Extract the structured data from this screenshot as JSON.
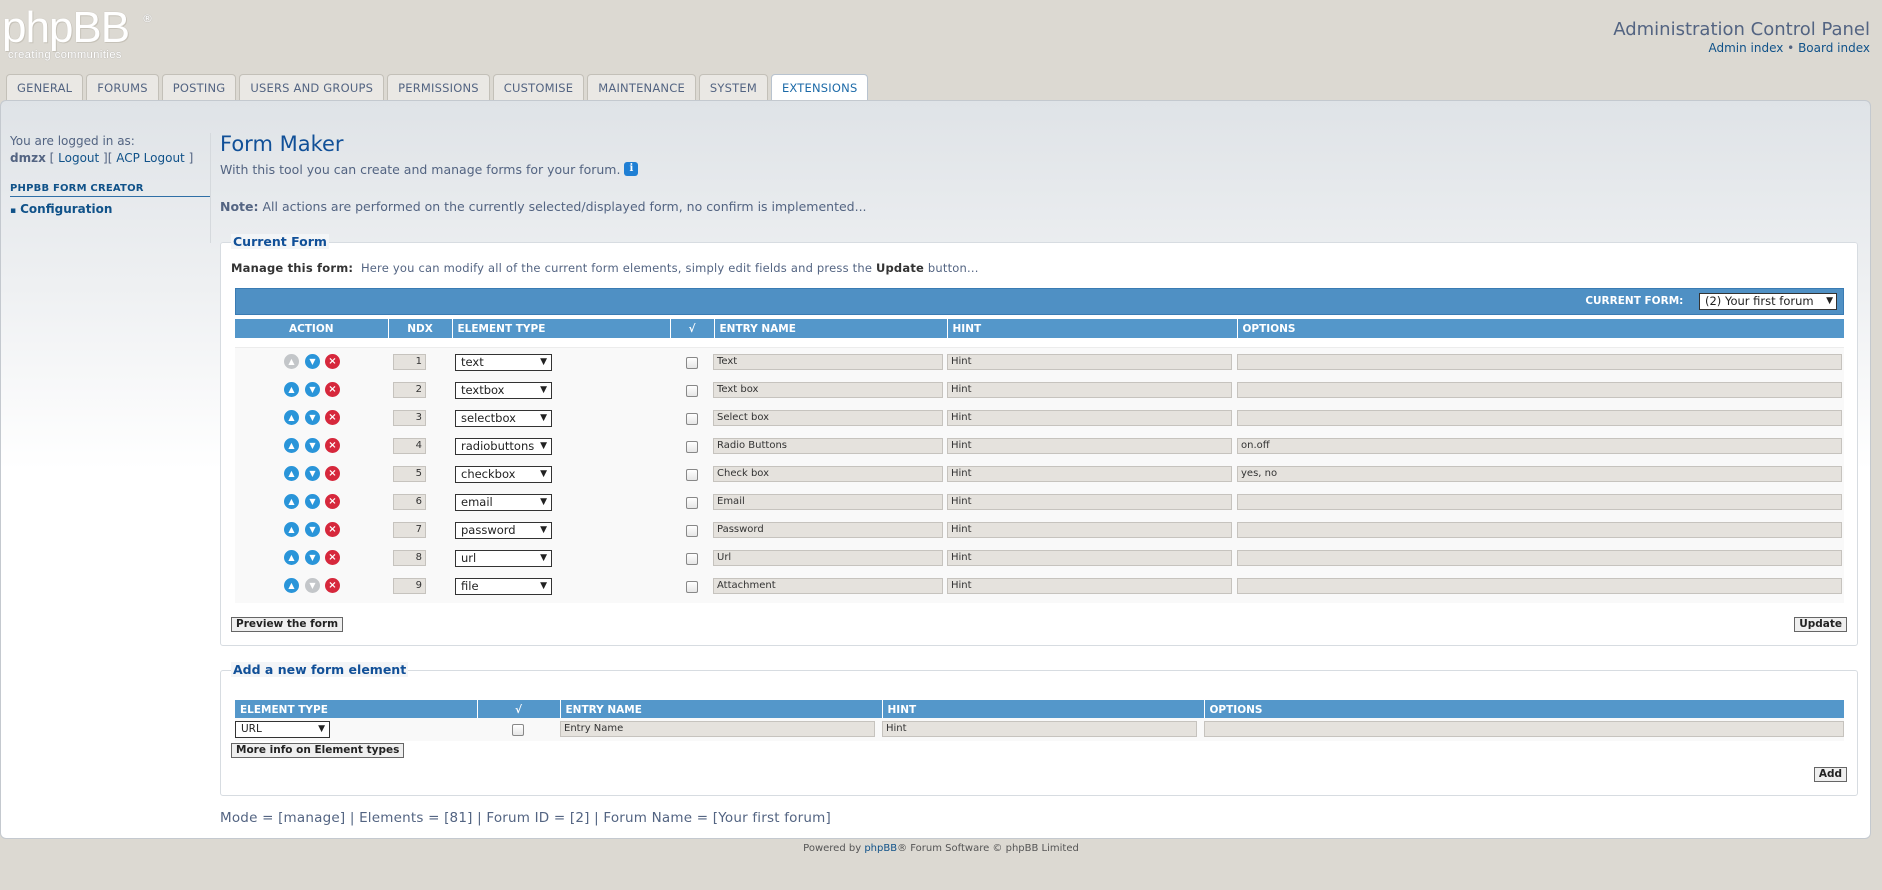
{
  "header": {
    "logo_text": "phpBB",
    "logo_tagline": "creating communities",
    "logo_reg": "®",
    "acp_title": "Administration Control Panel",
    "admin_index": "Admin index",
    "separator": "•",
    "board_index": "Board index"
  },
  "tabs": [
    {
      "label": "GENERAL"
    },
    {
      "label": "FORUMS"
    },
    {
      "label": "POSTING"
    },
    {
      "label": "USERS AND GROUPS"
    },
    {
      "label": "PERMISSIONS"
    },
    {
      "label": "CUSTOMISE"
    },
    {
      "label": "MAINTENANCE"
    },
    {
      "label": "SYSTEM"
    },
    {
      "label": "EXTENSIONS",
      "active": true
    }
  ],
  "sidebar": {
    "logged_in_as": "You are logged in as:",
    "username": "dmzx",
    "logout": "Logout",
    "acp_logout": "ACP Logout",
    "menu_heading": "PHPBB FORM CREATOR",
    "menu_item": "Configuration"
  },
  "main": {
    "title": "Form Maker",
    "intro": "With this tool you can create and manage forms for your forum.",
    "info_icon": "i",
    "note_label": "Note:",
    "note_text": "All actions are performed on the currently selected/displayed form, no confirm is implemented..."
  },
  "current_form": {
    "legend": "Current Form",
    "manage_label": "Manage this form:",
    "manage_text_1": "Here you can modify all of the current form elements, simply edit fields and press the",
    "manage_update_word": "Update",
    "manage_text_2": "button...",
    "selector_label": "CURRENT FORM:",
    "selector_value": "(2) Your first forum",
    "columns": [
      "ACTION",
      "NDX",
      "ELEMENT TYPE",
      "√",
      "ENTRY NAME",
      "HINT",
      "OPTIONS"
    ],
    "rows": [
      {
        "ndx": "1",
        "type": "text",
        "name": "Text",
        "hint": "Hint",
        "options": "",
        "up_enabled": false,
        "down_enabled": true
      },
      {
        "ndx": "2",
        "type": "textbox",
        "name": "Text box",
        "hint": "Hint",
        "options": "",
        "up_enabled": true,
        "down_enabled": true
      },
      {
        "ndx": "3",
        "type": "selectbox",
        "name": "Select box",
        "hint": "Hint",
        "options": "",
        "up_enabled": true,
        "down_enabled": true
      },
      {
        "ndx": "4",
        "type": "radiobuttons",
        "name": "Radio Buttons",
        "hint": "Hint",
        "options": "on.off",
        "up_enabled": true,
        "down_enabled": true
      },
      {
        "ndx": "5",
        "type": "checkbox",
        "name": "Check box",
        "hint": "Hint",
        "options": "yes, no",
        "up_enabled": true,
        "down_enabled": true
      },
      {
        "ndx": "6",
        "type": "email",
        "name": "Email",
        "hint": "Hint",
        "options": "",
        "up_enabled": true,
        "down_enabled": true
      },
      {
        "ndx": "7",
        "type": "password",
        "name": "Password",
        "hint": "Hint",
        "options": "",
        "up_enabled": true,
        "down_enabled": true
      },
      {
        "ndx": "8",
        "type": "url",
        "name": "Url",
        "hint": "Hint",
        "options": "",
        "up_enabled": true,
        "down_enabled": true
      },
      {
        "ndx": "9",
        "type": "file",
        "name": "Attachment",
        "hint": "Hint",
        "options": "",
        "up_enabled": true,
        "down_enabled": false
      }
    ],
    "preview_button": "Preview the form",
    "update_button": "Update"
  },
  "new_element": {
    "legend": "Add a new form element",
    "columns": [
      "ELEMENT TYPE",
      "√",
      "ENTRY NAME",
      "HINT",
      "OPTIONS"
    ],
    "type_value": "URL",
    "name_value": "Entry Name",
    "hint_value": "Hint",
    "options_value": "",
    "more_info_button": "More info on Element types",
    "add_button": "Add"
  },
  "status_line": "Mode = [manage] | Elements = [81] | Forum ID = [2] | Forum Name = [Your first forum]",
  "footer": {
    "powered_prefix": "Powered by",
    "phpbb_link": "phpBB",
    "powered_suffix": "® Forum Software © phpBB Limited"
  },
  "icons": {
    "up": "arrow-up-icon",
    "down": "arrow-down-icon",
    "delete": "delete-icon",
    "dropdown": "▼"
  },
  "colors": {
    "accent": "#115098",
    "table_header": "#5497ca",
    "delete": "#d6283c",
    "move": "#2a95d9"
  }
}
